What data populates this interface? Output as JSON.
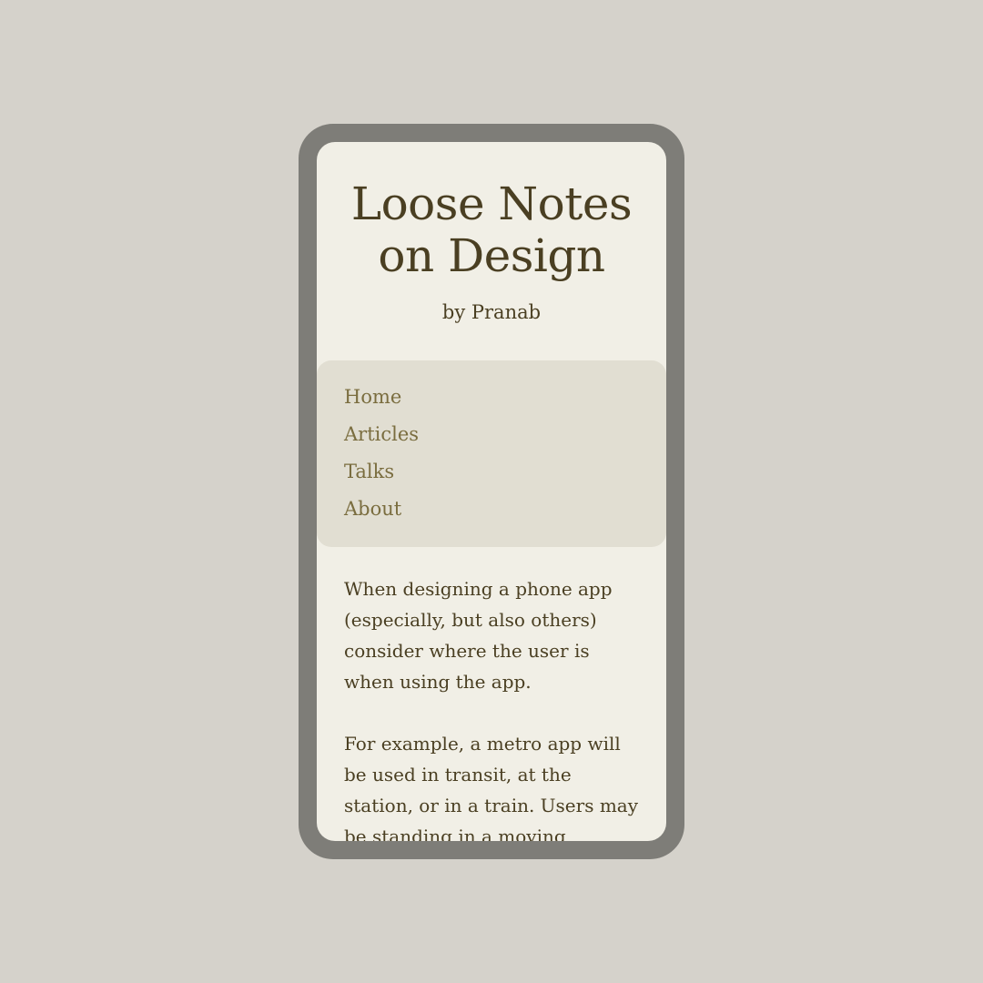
{
  "site": {
    "title_line1": "Loose Notes",
    "title_line2": "on Design",
    "byline": "by Pranab"
  },
  "nav": {
    "items": [
      {
        "label": "Home"
      },
      {
        "label": "Articles"
      },
      {
        "label": "Talks"
      },
      {
        "label": "About"
      }
    ]
  },
  "article": {
    "paragraphs": [
      "When designing a phone app (especially, but also others) consider where the user is when using the app.",
      "For example, a metro app will be used in transit, at the station, or in a train. Users may be standing in a moving"
    ]
  },
  "colors": {
    "page_background": "#d5d2cb",
    "phone_frame": "#7e7d78",
    "screen_background": "#f1efe6",
    "nav_background": "#e1ded2",
    "text": "#4a3f22",
    "link": "#7a6d3f"
  }
}
